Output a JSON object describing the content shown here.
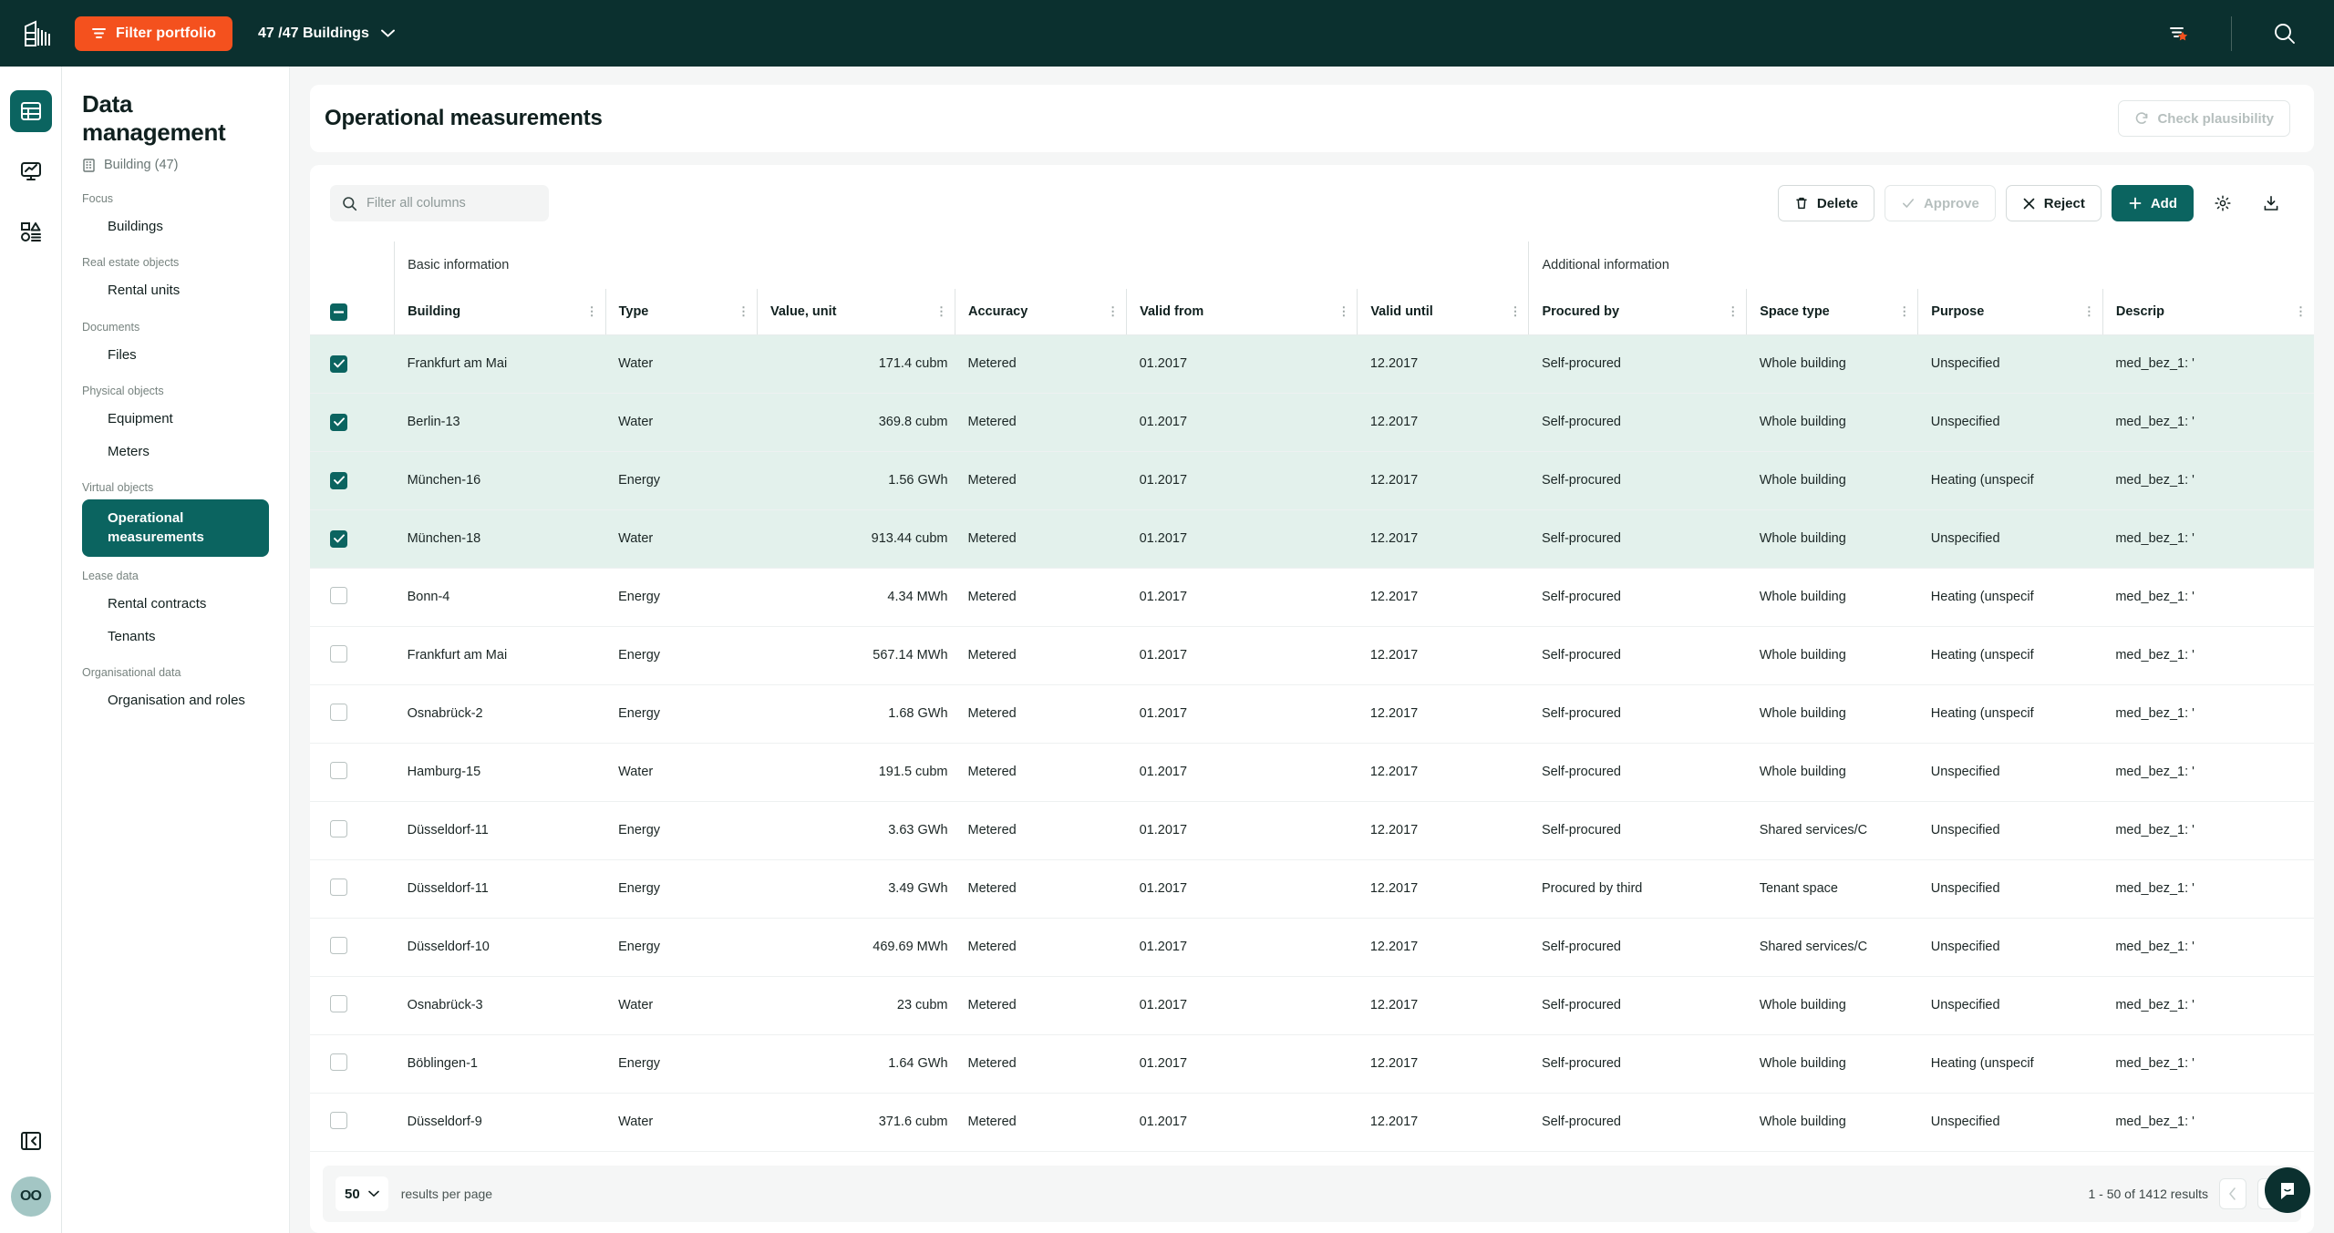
{
  "topbar": {
    "logo_icon": "building-logo-icon",
    "filter_portfolio_label": "Filter portfolio",
    "filter_icon": "filter-lines-icon",
    "buildings_selector": "47 /47 Buildings",
    "chevron_icon": "chevron-down-icon",
    "saved_filter_icon": "filter-star-icon",
    "search_icon": "search-icon",
    "bg_color": "#0b302f",
    "accent_color": "#f4511e"
  },
  "rail": {
    "items": [
      {
        "name": "data-management",
        "icon": "table-grid-icon",
        "active": true
      },
      {
        "name": "analytics",
        "icon": "monitor-chart-icon",
        "active": false
      },
      {
        "name": "shapes",
        "icon": "shapes-list-icon",
        "active": false
      }
    ],
    "collapse_icon": "collapse-panel-icon",
    "avatar_initials": "OO",
    "active_color": "#0b6460",
    "avatar_color": "#a3c6c4"
  },
  "sidebar": {
    "title": "Data management",
    "subtitle": "Building (47)",
    "subtitle_icon": "building-icon",
    "groups": [
      {
        "label": "Focus",
        "items": [
          {
            "label": "Buildings",
            "active": false
          }
        ]
      },
      {
        "label": "Real estate objects",
        "items": [
          {
            "label": "Rental units",
            "active": false
          }
        ]
      },
      {
        "label": "Documents",
        "items": [
          {
            "label": "Files",
            "active": false
          }
        ]
      },
      {
        "label": "Physical objects",
        "items": [
          {
            "label": "Equipment",
            "active": false
          },
          {
            "label": "Meters",
            "active": false
          }
        ]
      },
      {
        "label": "Virtual objects",
        "items": [
          {
            "label": "Operational measurements",
            "active": true
          }
        ]
      },
      {
        "label": "Lease data",
        "items": [
          {
            "label": "Rental contracts",
            "active": false
          },
          {
            "label": "Tenants",
            "active": false
          }
        ]
      },
      {
        "label": "Organisational data",
        "items": [
          {
            "label": "Organisation and roles",
            "active": false
          }
        ]
      }
    ]
  },
  "header": {
    "page_title": "Operational measurements",
    "check_plausibility_label": "Check plausibility",
    "check_plausibility_icon": "refresh-icon",
    "check_plausibility_disabled": true
  },
  "toolbar": {
    "search_placeholder": "Filter all columns",
    "search_value": "",
    "search_icon": "search-icon",
    "delete_label": "Delete",
    "delete_icon": "trash-icon",
    "approve_label": "Approve",
    "approve_icon": "check-icon",
    "approve_disabled": true,
    "reject_label": "Reject",
    "reject_icon": "close-x-icon",
    "add_label": "Add",
    "add_icon": "plus-icon",
    "settings_icon": "gear-icon",
    "download_icon": "download-icon"
  },
  "table": {
    "group_headers": [
      {
        "label": "Basic information"
      },
      {
        "label": "Additional information"
      }
    ],
    "columns": [
      {
        "key": "building",
        "label": "Building",
        "align": "left"
      },
      {
        "key": "type",
        "label": "Type",
        "align": "left"
      },
      {
        "key": "value",
        "label": "Value, unit",
        "align": "right"
      },
      {
        "key": "accuracy",
        "label": "Accuracy",
        "align": "left"
      },
      {
        "key": "valid_from",
        "label": "Valid from",
        "align": "left"
      },
      {
        "key": "valid_until",
        "label": "Valid until",
        "align": "left"
      },
      {
        "key": "procured_by",
        "label": "Procured by",
        "align": "left"
      },
      {
        "key": "space_type",
        "label": "Space type",
        "align": "left"
      },
      {
        "key": "purpose",
        "label": "Purpose",
        "align": "left"
      },
      {
        "key": "description",
        "label": "Descrip",
        "align": "left"
      }
    ],
    "select_all_state": "indeterminate",
    "rows": [
      {
        "selected": true,
        "building": "Frankfurt am Mai",
        "type": "Water",
        "value": "171.4 cubm",
        "accuracy": "Metered",
        "valid_from": "01.2017",
        "valid_until": "12.2017",
        "procured_by": "Self-procured",
        "space_type": "Whole building",
        "purpose": "Unspecified",
        "description": "med_bez_1: '"
      },
      {
        "selected": true,
        "building": "Berlin-13",
        "type": "Water",
        "value": "369.8 cubm",
        "accuracy": "Metered",
        "valid_from": "01.2017",
        "valid_until": "12.2017",
        "procured_by": "Self-procured",
        "space_type": "Whole building",
        "purpose": "Unspecified",
        "description": "med_bez_1: '"
      },
      {
        "selected": true,
        "building": "München-16",
        "type": "Energy",
        "value": "1.56 GWh",
        "accuracy": "Metered",
        "valid_from": "01.2017",
        "valid_until": "12.2017",
        "procured_by": "Self-procured",
        "space_type": "Whole building",
        "purpose": "Heating (unspecif",
        "description": "med_bez_1: '"
      },
      {
        "selected": true,
        "building": "München-18",
        "type": "Water",
        "value": "913.44 cubm",
        "accuracy": "Metered",
        "valid_from": "01.2017",
        "valid_until": "12.2017",
        "procured_by": "Self-procured",
        "space_type": "Whole building",
        "purpose": "Unspecified",
        "description": "med_bez_1: '"
      },
      {
        "selected": false,
        "building": "Bonn-4",
        "type": "Energy",
        "value": "4.34 MWh",
        "accuracy": "Metered",
        "valid_from": "01.2017",
        "valid_until": "12.2017",
        "procured_by": "Self-procured",
        "space_type": "Whole building",
        "purpose": "Heating (unspecif",
        "description": "med_bez_1: '"
      },
      {
        "selected": false,
        "building": "Frankfurt am Mai",
        "type": "Energy",
        "value": "567.14 MWh",
        "accuracy": "Metered",
        "valid_from": "01.2017",
        "valid_until": "12.2017",
        "procured_by": "Self-procured",
        "space_type": "Whole building",
        "purpose": "Heating (unspecif",
        "description": "med_bez_1: '"
      },
      {
        "selected": false,
        "building": "Osnabrück-2",
        "type": "Energy",
        "value": "1.68 GWh",
        "accuracy": "Metered",
        "valid_from": "01.2017",
        "valid_until": "12.2017",
        "procured_by": "Self-procured",
        "space_type": "Whole building",
        "purpose": "Heating (unspecif",
        "description": "med_bez_1: '"
      },
      {
        "selected": false,
        "building": "Hamburg-15",
        "type": "Water",
        "value": "191.5 cubm",
        "accuracy": "Metered",
        "valid_from": "01.2017",
        "valid_until": "12.2017",
        "procured_by": "Self-procured",
        "space_type": "Whole building",
        "purpose": "Unspecified",
        "description": "med_bez_1: '"
      },
      {
        "selected": false,
        "building": "Düsseldorf-11",
        "type": "Energy",
        "value": "3.63 GWh",
        "accuracy": "Metered",
        "valid_from": "01.2017",
        "valid_until": "12.2017",
        "procured_by": "Self-procured",
        "space_type": "Shared services/C",
        "purpose": "Unspecified",
        "description": "med_bez_1: '"
      },
      {
        "selected": false,
        "building": "Düsseldorf-11",
        "type": "Energy",
        "value": "3.49 GWh",
        "accuracy": "Metered",
        "valid_from": "01.2017",
        "valid_until": "12.2017",
        "procured_by": "Procured by third",
        "space_type": "Tenant space",
        "purpose": "Unspecified",
        "description": "med_bez_1: '"
      },
      {
        "selected": false,
        "building": "Düsseldorf-10",
        "type": "Energy",
        "value": "469.69 MWh",
        "accuracy": "Metered",
        "valid_from": "01.2017",
        "valid_until": "12.2017",
        "procured_by": "Self-procured",
        "space_type": "Shared services/C",
        "purpose": "Unspecified",
        "description": "med_bez_1: '"
      },
      {
        "selected": false,
        "building": "Osnabrück-3",
        "type": "Water",
        "value": "23 cubm",
        "accuracy": "Metered",
        "valid_from": "01.2017",
        "valid_until": "12.2017",
        "procured_by": "Self-procured",
        "space_type": "Whole building",
        "purpose": "Unspecified",
        "description": "med_bez_1: '"
      },
      {
        "selected": false,
        "building": "Böblingen-1",
        "type": "Energy",
        "value": "1.64 GWh",
        "accuracy": "Metered",
        "valid_from": "01.2017",
        "valid_until": "12.2017",
        "procured_by": "Self-procured",
        "space_type": "Whole building",
        "purpose": "Heating (unspecif",
        "description": "med_bez_1: '"
      },
      {
        "selected": false,
        "building": "Düsseldorf-9",
        "type": "Water",
        "value": "371.6 cubm",
        "accuracy": "Metered",
        "valid_from": "01.2017",
        "valid_until": "12.2017",
        "procured_by": "Self-procured",
        "space_type": "Whole building",
        "purpose": "Unspecified",
        "description": "med_bez_1: '"
      }
    ]
  },
  "pagination": {
    "per_page_value": "50",
    "per_page_label": "results per page",
    "range_text": "1 - 50 of  1412 results",
    "prev_icon": "chevron-left-icon",
    "next_icon": "chevron-right-icon",
    "prev_disabled": true
  },
  "chat": {
    "icon": "chat-bubble-icon"
  }
}
